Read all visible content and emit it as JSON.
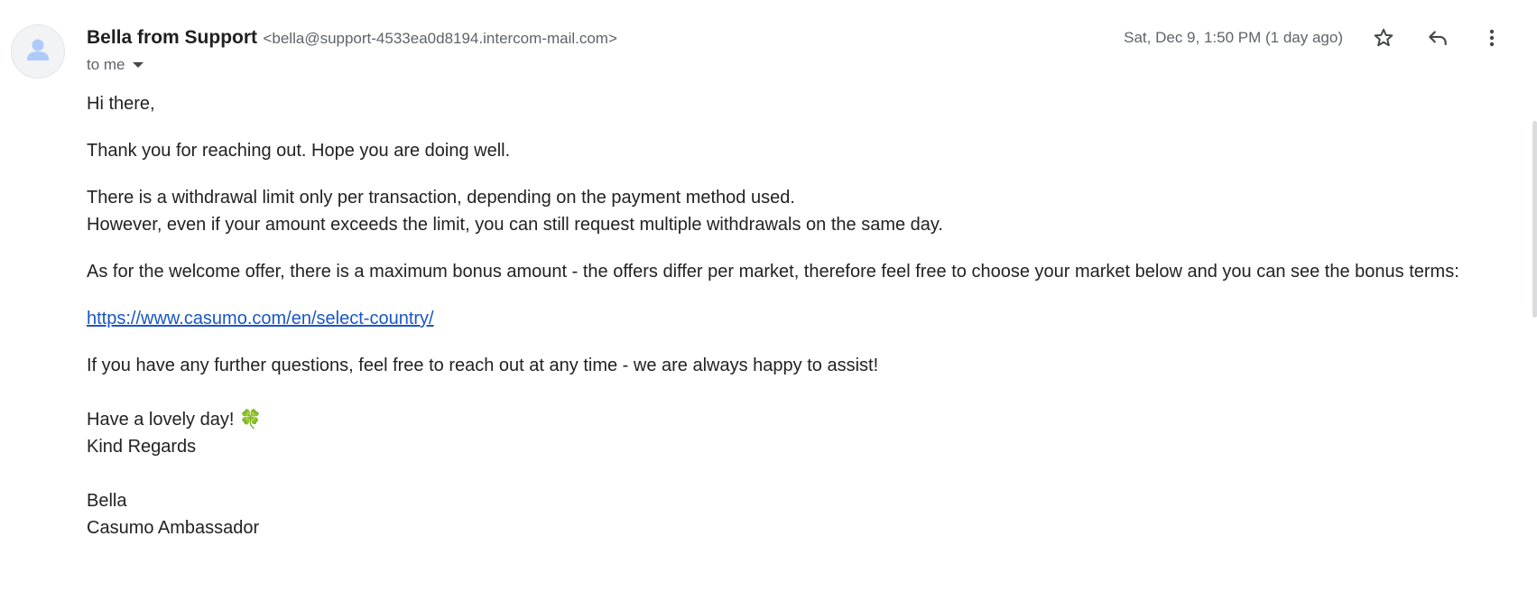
{
  "header": {
    "sender_name": "Bella from Support",
    "sender_email": "<bella@support-4533ea0d8194.intercom-mail.com>",
    "recipient_label": "to me",
    "timestamp": "Sat, Dec 9, 1:50 PM (1 day ago)",
    "actions": {
      "star_icon": "star-icon",
      "reply_icon": "reply-icon",
      "more_icon": "more-vert-icon"
    }
  },
  "message": {
    "greeting": "Hi there,",
    "para1": "Thank you for reaching out. Hope you are doing well.",
    "para2_line1": "There is a withdrawal limit only per transaction, depending on the payment method used.",
    "para2_line2": "However, even if your amount exceeds the limit, you can still request multiple withdrawals on the same day.",
    "para3": "As for the welcome offer, there is a maximum bonus amount - the offers differ per market, therefore feel free to choose your market below and you can see the bonus terms:",
    "link": "https://www.casumo.com/en/select-country/",
    "para4": "If you have any further questions, feel free to reach out at any time - we are always happy to assist!",
    "signoff_line1": "Have a lovely day!",
    "signoff_emoji": "🍀",
    "signoff_line2": "Kind Regards",
    "signature_name": "Bella",
    "signature_title": "Casumo Ambassador"
  },
  "colors": {
    "link": "#1a56c4",
    "secondary_text": "#5f6368",
    "avatar_icon": "#a8c7fa"
  }
}
